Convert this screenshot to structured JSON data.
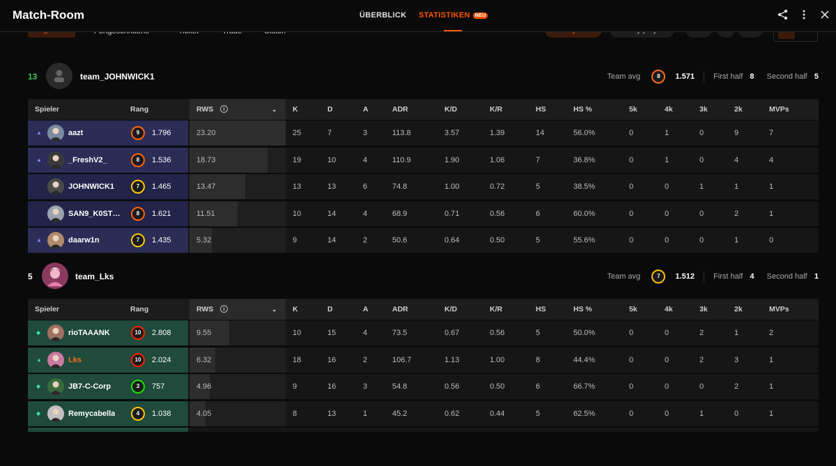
{
  "header": {
    "title": "Match-Room",
    "tabs": [
      {
        "label": "ÜBERBLICK"
      },
      {
        "label": "STATISTIKEN",
        "badge": "NEU",
        "active": true
      }
    ],
    "icons": [
      "share-icon",
      "more-vertical-icon",
      "close-icon"
    ]
  },
  "filters": {
    "tabs": [
      "Allgemein",
      "Fortgeschrittene",
      "Ticket",
      "Trade",
      "Clutch"
    ],
    "sort_team": "Sort by team",
    "sort_players": "Sort by players",
    "scope": "Alle",
    "extra": [
      "1",
      "CT"
    ]
  },
  "columns": {
    "player": "Spieler",
    "rank": "Rang",
    "rws": "RWS",
    "k": "K",
    "d": "D",
    "a": "A",
    "adr": "ADR",
    "kd": "K/D",
    "kr": "K/R",
    "hs": "HS",
    "hsp": "HS %",
    "k5": "5k",
    "k4": "4k",
    "k3": "3k",
    "k2": "2k",
    "mvps": "MVPs"
  },
  "labels": {
    "team_avg": "Team avg",
    "first_half": "First half",
    "second_half": "Second half"
  },
  "colors": {
    "accent": "#ff5500",
    "win": "#3fc55f",
    "blue_team": "#2b2d57",
    "green_team": "#1f4a3c"
  },
  "teams": [
    {
      "score": "13",
      "name": "team_JOHNWICK1",
      "avg_level": "8",
      "avg_elo": "1.571",
      "first_half": "8",
      "second_half": "5",
      "players": [
        {
          "name": "aazt",
          "level": "9",
          "elo": "1.796",
          "rws": "23.20",
          "rws_frac": 1.0,
          "k": "25",
          "d": "7",
          "a": "3",
          "adr": "113.8",
          "kd": "3.57",
          "kr": "1.39",
          "hs": "14",
          "hsp": "56.0%",
          "k5": "0",
          "k4": "1",
          "k3": "0",
          "k2": "9",
          "mvps": "7"
        },
        {
          "name": "_FreshV2_",
          "level": "8",
          "elo": "1.536",
          "rws": "18.73",
          "rws_frac": 0.81,
          "k": "19",
          "d": "10",
          "a": "4",
          "adr": "110.9",
          "kd": "1.90",
          "kr": "1.06",
          "hs": "7",
          "hsp": "36.8%",
          "k5": "0",
          "k4": "1",
          "k3": "0",
          "k2": "4",
          "mvps": "4"
        },
        {
          "name": "JOHNWICK1",
          "level": "7",
          "elo": "1.465",
          "rws": "13.47",
          "rws_frac": 0.58,
          "k": "13",
          "d": "13",
          "a": "6",
          "adr": "74.8",
          "kd": "1.00",
          "kr": "0.72",
          "hs": "5",
          "hsp": "38.5%",
          "k5": "0",
          "k4": "0",
          "k3": "1",
          "k2": "1",
          "mvps": "1"
        },
        {
          "name": "SAN9_K0STR...",
          "level": "8",
          "elo": "1.621",
          "rws": "11.51",
          "rws_frac": 0.5,
          "k": "10",
          "d": "14",
          "a": "4",
          "adr": "68.9",
          "kd": "0.71",
          "kr": "0.56",
          "hs": "6",
          "hsp": "60.0%",
          "k5": "0",
          "k4": "0",
          "k3": "0",
          "k2": "2",
          "mvps": "1"
        },
        {
          "name": "daarw1n",
          "level": "7",
          "elo": "1.435",
          "rws": "5.32",
          "rws_frac": 0.23,
          "k": "9",
          "d": "14",
          "a": "2",
          "adr": "50.6",
          "kd": "0.64",
          "kr": "0.50",
          "hs": "5",
          "hsp": "55.6%",
          "k5": "0",
          "k4": "0",
          "k3": "0",
          "k2": "1",
          "mvps": "0"
        }
      ]
    },
    {
      "score": "5",
      "name": "team_Lks",
      "avg_level": "7",
      "avg_elo": "1.512",
      "first_half": "4",
      "second_half": "1",
      "players": [
        {
          "name": "rioTAAANK",
          "level": "10",
          "elo": "2.808",
          "rws": "9.55",
          "rws_frac": 0.41,
          "k": "10",
          "d": "15",
          "a": "4",
          "adr": "73.5",
          "kd": "0.67",
          "kr": "0.56",
          "hs": "5",
          "hsp": "50.0%",
          "k5": "0",
          "k4": "0",
          "k3": "2",
          "k2": "1",
          "mvps": "2"
        },
        {
          "name": "Lks",
          "level": "10",
          "elo": "2.024",
          "rws": "6.32",
          "rws_frac": 0.27,
          "k": "18",
          "d": "16",
          "a": "2",
          "adr": "106.7",
          "kd": "1.13",
          "kr": "1.00",
          "hs": "8",
          "hsp": "44.4%",
          "k5": "0",
          "k4": "0",
          "k3": "2",
          "k2": "3",
          "mvps": "1"
        },
        {
          "name": "JB7-C-Corp",
          "level": "3",
          "elo": "757",
          "rws": "4.96",
          "rws_frac": 0.21,
          "k": "9",
          "d": "16",
          "a": "3",
          "adr": "54.8",
          "kd": "0.56",
          "kr": "0.50",
          "hs": "6",
          "hsp": "66.7%",
          "k5": "0",
          "k4": "0",
          "k3": "0",
          "k2": "2",
          "mvps": "1"
        },
        {
          "name": "Remycabella",
          "level": "4",
          "elo": "1.038",
          "rws": "4.05",
          "rws_frac": 0.17,
          "k": "8",
          "d": "13",
          "a": "1",
          "adr": "45.2",
          "kd": "0.62",
          "kr": "0.44",
          "hs": "5",
          "hsp": "62.5%",
          "k5": "0",
          "k4": "0",
          "k3": "1",
          "k2": "0",
          "mvps": "1"
        }
      ]
    }
  ]
}
